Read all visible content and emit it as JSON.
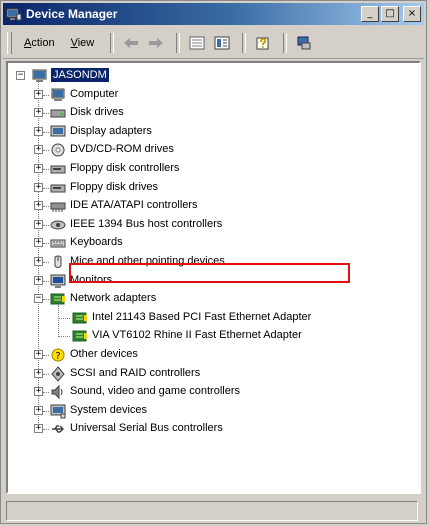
{
  "window": {
    "title": "Device Manager",
    "controls": {
      "minimize": "_",
      "maximize": "□",
      "close": "×"
    }
  },
  "menu": {
    "items": [
      {
        "label": "Action",
        "accel": "A"
      },
      {
        "label": "View",
        "accel": "V"
      }
    ]
  },
  "toolbar": {
    "buttons": [
      "back-icon",
      "forward-icon",
      "list-view-icon",
      "properties-view-icon",
      "help-icon",
      "scan-hardware-icon"
    ]
  },
  "tree": {
    "root": "JASONDM",
    "categories": [
      "Computer",
      "Disk drives",
      "Display adapters",
      "DVD/CD-ROM drives",
      "Floppy disk controllers",
      "Floppy disk drives",
      "IDE ATA/ATAPI controllers",
      "IEEE 1394 Bus host controllers",
      "Keyboards",
      "Mice and other pointing devices",
      "Monitors",
      "Network adapters",
      "Other devices",
      "SCSI and RAID controllers",
      "Sound, video and game controllers",
      "System devices",
      "Universal Serial Bus controllers"
    ],
    "network_children": [
      "Intel 21143 Based PCI Fast Ethernet Adapter",
      "VIA VT6102 Rhine II Fast Ethernet Adapter"
    ],
    "expanded_category": "Network adapters",
    "highlighted_item": "VIA VT6102 Rhine II Fast Ethernet Adapter"
  },
  "colors": {
    "titlebar": "#0a246a",
    "highlight_box": "#e01010",
    "window_bg": "#d4d0c8"
  }
}
